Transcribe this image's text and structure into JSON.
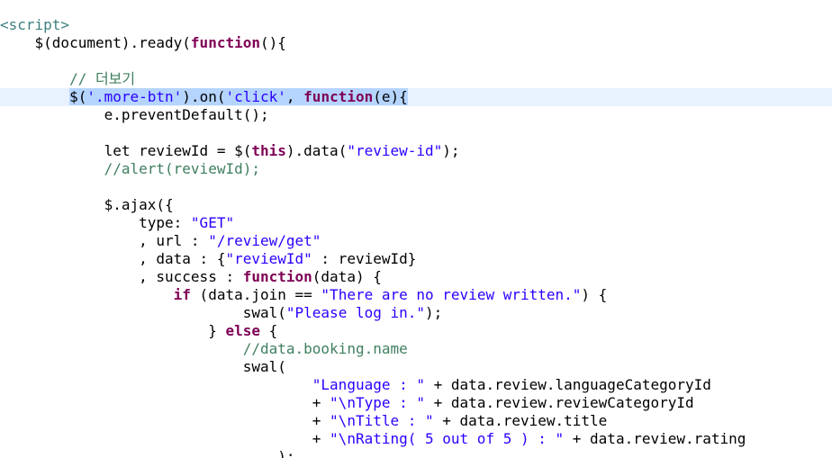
{
  "editor": {
    "current_line": 5,
    "lines": [
      {
        "tokens": [
          {
            "t": "<script>",
            "c": "tag"
          }
        ]
      },
      {
        "tokens": [
          {
            "t": "    $(document).ready(",
            "c": "plain"
          },
          {
            "t": "function",
            "c": "keyword"
          },
          {
            "t": "(){",
            "c": "plain"
          }
        ]
      },
      {
        "tokens": []
      },
      {
        "tokens": [
          {
            "t": "        // 더보기",
            "c": "comment"
          }
        ]
      },
      {
        "tokens": [
          {
            "t": "        ",
            "c": "plain"
          },
          {
            "t": "$(",
            "c": "plain",
            "s": 1
          },
          {
            "t": "'.more-btn'",
            "c": "string",
            "s": 1
          },
          {
            "t": ").on(",
            "c": "plain",
            "s": 1
          },
          {
            "t": "'click'",
            "c": "string",
            "s": 1
          },
          {
            "t": ", ",
            "c": "plain",
            "s": 1
          },
          {
            "t": "function",
            "c": "keyword",
            "s": 1
          },
          {
            "t": "(e){",
            "c": "plain",
            "s": 1
          }
        ]
      },
      {
        "tokens": [
          {
            "t": "            e.preventDefault();",
            "c": "plain"
          }
        ]
      },
      {
        "tokens": []
      },
      {
        "tokens": [
          {
            "t": "            let reviewId = $(",
            "c": "plain"
          },
          {
            "t": "this",
            "c": "keyword"
          },
          {
            "t": ").data(",
            "c": "plain"
          },
          {
            "t": "\"review-id\"",
            "c": "string"
          },
          {
            "t": ");",
            "c": "plain"
          }
        ]
      },
      {
        "tokens": [
          {
            "t": "            //alert(reviewId);",
            "c": "comment"
          }
        ]
      },
      {
        "tokens": []
      },
      {
        "tokens": [
          {
            "t": "            $.ajax({",
            "c": "plain"
          }
        ]
      },
      {
        "tokens": [
          {
            "t": "                type: ",
            "c": "plain"
          },
          {
            "t": "\"GET\"",
            "c": "string"
          }
        ]
      },
      {
        "tokens": [
          {
            "t": "                , url : ",
            "c": "plain"
          },
          {
            "t": "\"/review/get\"",
            "c": "string"
          }
        ]
      },
      {
        "tokens": [
          {
            "t": "                , data : {",
            "c": "plain"
          },
          {
            "t": "\"reviewId\"",
            "c": "string"
          },
          {
            "t": " : reviewId}",
            "c": "plain"
          }
        ]
      },
      {
        "tokens": [
          {
            "t": "                , success : ",
            "c": "plain"
          },
          {
            "t": "function",
            "c": "keyword"
          },
          {
            "t": "(data) {",
            "c": "plain"
          }
        ]
      },
      {
        "tokens": [
          {
            "t": "                    ",
            "c": "plain"
          },
          {
            "t": "if",
            "c": "keyword"
          },
          {
            "t": " (data.join == ",
            "c": "plain"
          },
          {
            "t": "\"There are no review written.\"",
            "c": "string"
          },
          {
            "t": ") {",
            "c": "plain"
          }
        ]
      },
      {
        "tokens": [
          {
            "t": "                            swal(",
            "c": "plain"
          },
          {
            "t": "\"Please log in.\"",
            "c": "string"
          },
          {
            "t": ");",
            "c": "plain"
          }
        ]
      },
      {
        "tokens": [
          {
            "t": "                        } ",
            "c": "plain"
          },
          {
            "t": "else",
            "c": "keyword"
          },
          {
            "t": " {",
            "c": "plain"
          }
        ]
      },
      {
        "tokens": [
          {
            "t": "                            //data.booking.name",
            "c": "comment"
          }
        ]
      },
      {
        "tokens": [
          {
            "t": "                            swal(",
            "c": "plain"
          }
        ]
      },
      {
        "tokens": [
          {
            "t": "                                    ",
            "c": "plain"
          },
          {
            "t": "\"Language : \"",
            "c": "string"
          },
          {
            "t": " + data.review.languageCategoryId",
            "c": "plain"
          }
        ]
      },
      {
        "tokens": [
          {
            "t": "                                    + ",
            "c": "plain"
          },
          {
            "t": "\"\\nType : \"",
            "c": "string"
          },
          {
            "t": " + data.review.reviewCategoryId",
            "c": "plain"
          }
        ]
      },
      {
        "tokens": [
          {
            "t": "                                    + ",
            "c": "plain"
          },
          {
            "t": "\"\\nTitle : \"",
            "c": "string"
          },
          {
            "t": " + data.review.title",
            "c": "plain"
          }
        ]
      },
      {
        "tokens": [
          {
            "t": "                                    + ",
            "c": "plain"
          },
          {
            "t": "\"\\nRating( 5 out of 5 ) : \"",
            "c": "string"
          },
          {
            "t": " + data.review.rating",
            "c": "plain"
          }
        ]
      },
      {
        "tokens": [
          {
            "t": "                                );",
            "c": "plain"
          }
        ]
      }
    ]
  }
}
